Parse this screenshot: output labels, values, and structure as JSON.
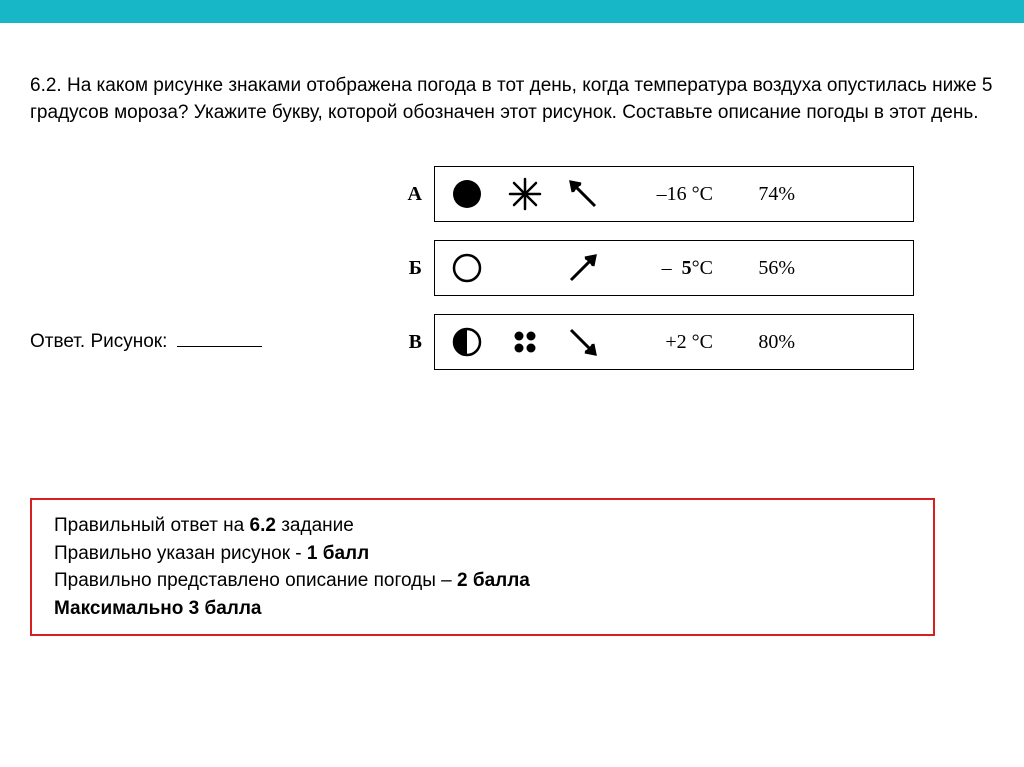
{
  "question": {
    "number": "6.2.",
    "text": "На каком рисунке знаками отображена погода в тот день, когда температура воздуха опустилась ниже 5 градусов мороза? Укажите букву, которой обозначен этот рисунок. Составьте описание погоды в этот день."
  },
  "options": [
    {
      "label": "А",
      "temperature": "–16 °С",
      "humidity": "74%"
    },
    {
      "label": "Б",
      "temperature": "– 5°С",
      "temp_bold": "5",
      "humidity": "56%"
    },
    {
      "label": "В",
      "temperature": "+2 °С",
      "humidity": "80%"
    }
  ],
  "answer": {
    "label": "Ответ. Рисунок:"
  },
  "scoring": {
    "line1": "Правильный ответ на ",
    "line1_bold": "6.2",
    "line1_end": " задание",
    "line2": "Правильно указан рисунок - ",
    "line2_bold": "1 балл",
    "line3": "Правильно представлено описание погоды – ",
    "line3_bold": "2 балла",
    "line4": "Максимально 3 балла"
  }
}
